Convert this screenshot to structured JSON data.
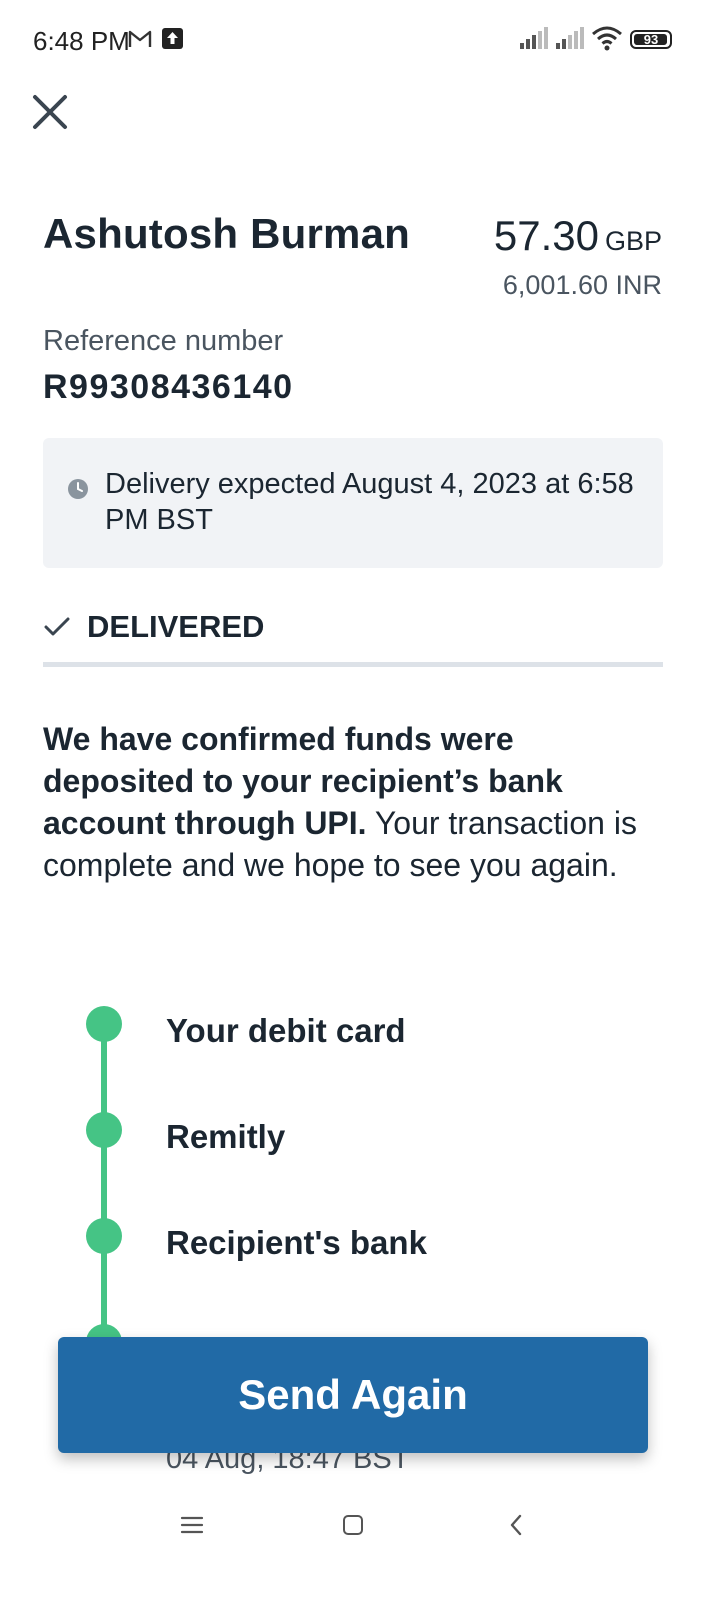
{
  "status_bar": {
    "time": "6:48 PM",
    "battery_level": "93",
    "icons": [
      "gmail-icon",
      "upload-icon",
      "signal-icon",
      "signal-icon",
      "wifi-icon",
      "battery-icon"
    ]
  },
  "recipient": {
    "name": "Ashutosh Burman"
  },
  "amount": {
    "value": "57.30",
    "currency": "GBP",
    "converted": "6,001.60 INR"
  },
  "reference": {
    "label": "Reference number",
    "value": "R99308436140"
  },
  "delivery": {
    "text": "Delivery expected August 4, 2023 at 6:58 PM BST"
  },
  "status": {
    "label": "DELIVERED"
  },
  "confirmation": {
    "bold": "We have confirmed funds were deposited to your recipient’s bank account through UPI.",
    "rest": " Your transaction is complete and we hope to see you again."
  },
  "timeline": {
    "steps": [
      {
        "label": "Your debit card"
      },
      {
        "label": "Remitly"
      },
      {
        "label": "Recipient's bank"
      }
    ],
    "timestamp": "04 Aug, 18:47 BST"
  },
  "actions": {
    "send_again": "Send Again"
  },
  "colors": {
    "accent": "#216aa6",
    "success": "#45c485",
    "text": "#1b2631",
    "panel": "#f1f3f6"
  }
}
